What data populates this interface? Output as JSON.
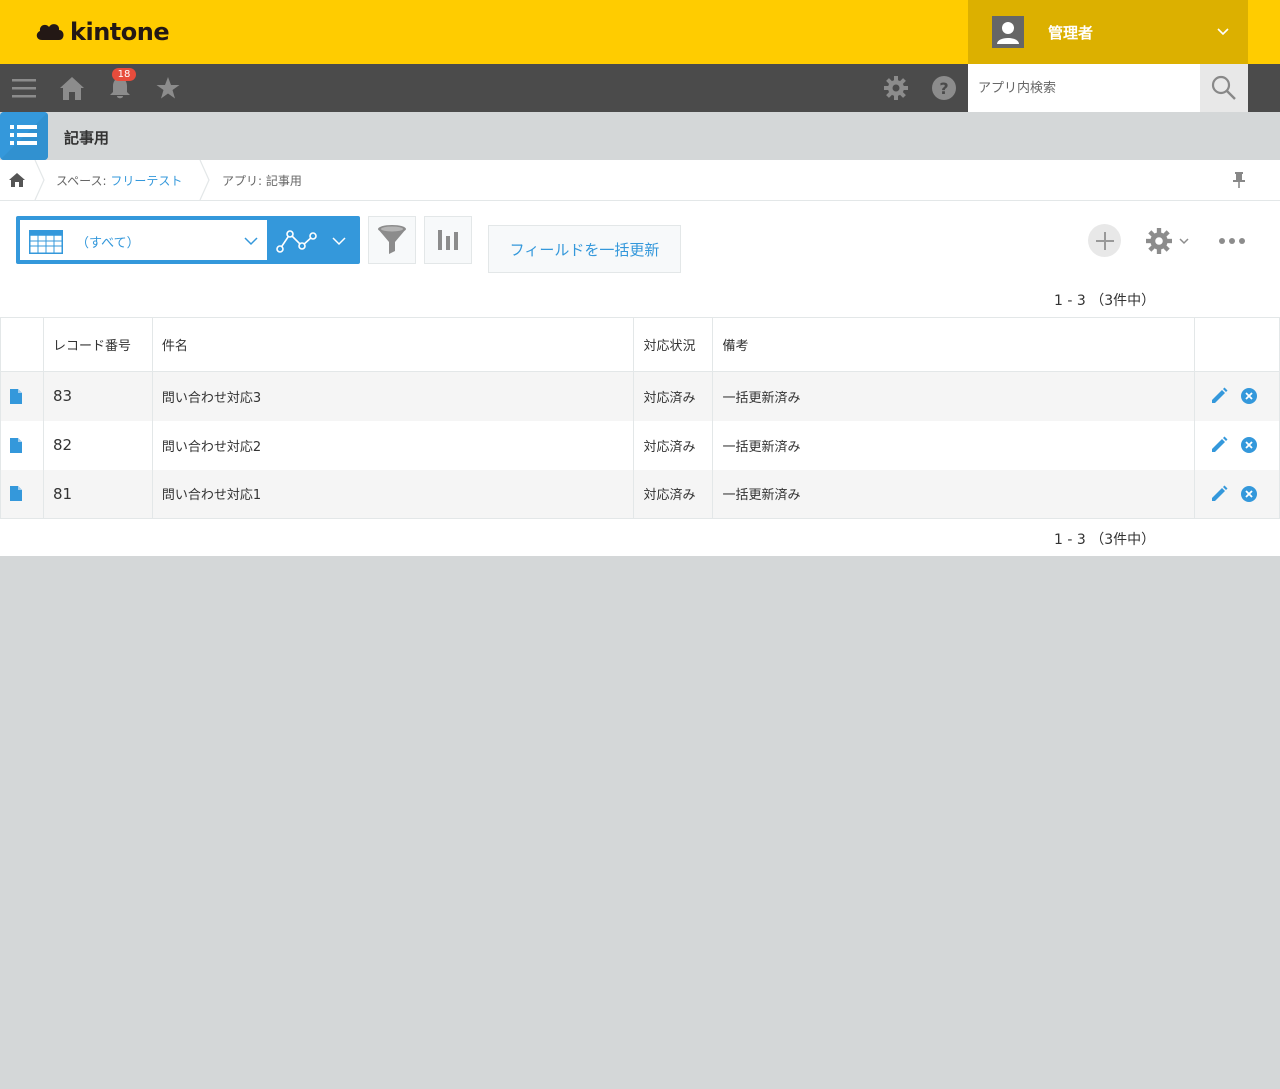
{
  "header": {
    "logo_text": "kintone",
    "user_name": "管理者"
  },
  "nav": {
    "notification_count": "18",
    "search_placeholder": "アプリ内検索"
  },
  "app": {
    "title": "記事用"
  },
  "breadcrumb": {
    "space_prefix": "スペース: ",
    "space_name": "フリーテスト",
    "app_label": "アプリ: 記事用"
  },
  "toolbar": {
    "view_name": "（すべて）",
    "bulk_update_label": "フィールドを一括更新"
  },
  "pager": {
    "top": "1 - 3 （3件中）",
    "bottom": "1 - 3 （3件中）"
  },
  "table": {
    "columns": [
      "レコード番号",
      "件名",
      "対応状況",
      "備考"
    ],
    "rows": [
      {
        "id": "83",
        "subject": "問い合わせ対応3",
        "status": "対応済み",
        "note": "一括更新済み"
      },
      {
        "id": "82",
        "subject": "問い合わせ対応2",
        "status": "対応済み",
        "note": "一括更新済み"
      },
      {
        "id": "81",
        "subject": "問い合わせ対応1",
        "status": "対応済み",
        "note": "一括更新済み"
      }
    ]
  },
  "colors": {
    "header_yellow": "#ffcc00",
    "user_area": "#dcb000",
    "nav_dark": "#4b4b4b",
    "accent_blue": "#3498db",
    "badge_red": "#e74c3c"
  }
}
